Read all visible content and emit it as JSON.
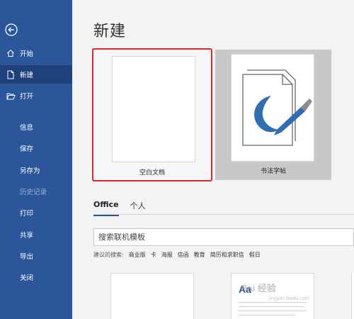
{
  "sidebar": {
    "back_icon": "back-arrow-icon",
    "items": [
      {
        "label": "开始",
        "icon": "home-icon"
      },
      {
        "label": "新建",
        "icon": "new-document-icon",
        "active": true
      },
      {
        "label": "打开",
        "icon": "open-folder-icon"
      },
      {
        "label": "信息"
      },
      {
        "label": "保存"
      },
      {
        "label": "另存为"
      },
      {
        "label": "历史记录",
        "disabled": true
      },
      {
        "label": "打印"
      },
      {
        "label": "共享"
      },
      {
        "label": "导出"
      },
      {
        "label": "关闭"
      }
    ]
  },
  "main": {
    "title": "新建",
    "templates": [
      {
        "label": "空白文档"
      },
      {
        "label": "书法字帖"
      }
    ],
    "tabs": [
      {
        "label": "Office",
        "active": true
      },
      {
        "label": "个人"
      }
    ],
    "search": {
      "placeholder": "搜索联机模板"
    },
    "suggested": {
      "label": "建议的搜索:",
      "keywords": [
        "商业版",
        "卡",
        "海报",
        "信函",
        "教育",
        "简历和求职信",
        "假日"
      ]
    },
    "preview_text": "Aa"
  },
  "watermark": {
    "text": "Bai 经验",
    "sub": "jingyan.baidu.com"
  },
  "colors": {
    "sidebar_bg": "#2b579a",
    "sidebar_active": "#1d4178",
    "highlight_border": "#d9282f",
    "calligraphy_blue": "#2f6db5"
  }
}
